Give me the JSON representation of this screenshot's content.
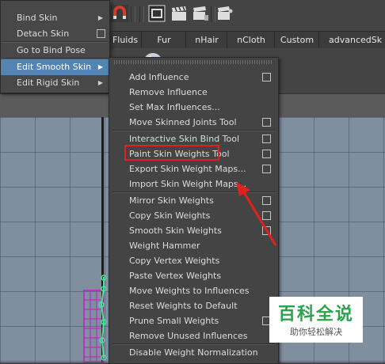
{
  "main_menu": {
    "items": [
      {
        "label": "Bind Skin",
        "submenu": true
      },
      {
        "label": "Detach Skin",
        "option_box": true
      },
      {
        "label": "Go to Bind Pose"
      },
      {
        "label": "Edit Smooth Skin",
        "submenu": true,
        "active": true
      },
      {
        "label": "Edit Rigid Skin",
        "submenu": true
      }
    ]
  },
  "shelf_tabs": [
    "Fluids",
    "Fur",
    "nHair",
    "nCloth",
    "Custom",
    "advancedSk"
  ],
  "submenu": {
    "items": [
      {
        "label": "Add Influence",
        "option_box": true
      },
      {
        "label": "Remove Influence",
        "option_box": false
      },
      {
        "label": "Set Max Influences...",
        "option_box": false
      },
      {
        "label": "Move Skinned Joints Tool",
        "option_box": true
      },
      {
        "label": "Interactive Skin Bind Tool",
        "option_box": true
      },
      {
        "label": "Paint Skin Weights Tool",
        "option_box": true,
        "highlighted": true
      },
      {
        "label": "Export Skin Weight Maps...",
        "option_box": true
      },
      {
        "label": "Import Skin Weight Maps...",
        "option_box": false
      },
      {
        "label": "Mirror Skin Weights",
        "option_box": true
      },
      {
        "label": "Copy Skin Weights",
        "option_box": true
      },
      {
        "label": "Smooth Skin Weights",
        "option_box": true
      },
      {
        "label": "Weight Hammer",
        "option_box": false
      },
      {
        "label": "Copy Vertex Weights",
        "option_box": false
      },
      {
        "label": "Paste Vertex Weights",
        "option_box": false
      },
      {
        "label": "Move Weights to Influences",
        "option_box": false
      },
      {
        "label": "Reset Weights to Default",
        "option_box": false
      },
      {
        "label": "Prune Small Weights",
        "option_box": true
      },
      {
        "label": "Remove Unused Influences",
        "option_box": false
      },
      {
        "label": "Disable Weight Normalization",
        "option_box": false
      }
    ]
  },
  "watermark": {
    "main": "百科全说",
    "sub": "助你轻松解决"
  },
  "colors": {
    "menu_bg": "#444444",
    "active_item": "#5284b4",
    "annotation_red": "#e0211f",
    "viewport": "#7f8fa0",
    "watermark_green": "#2aa44a"
  }
}
